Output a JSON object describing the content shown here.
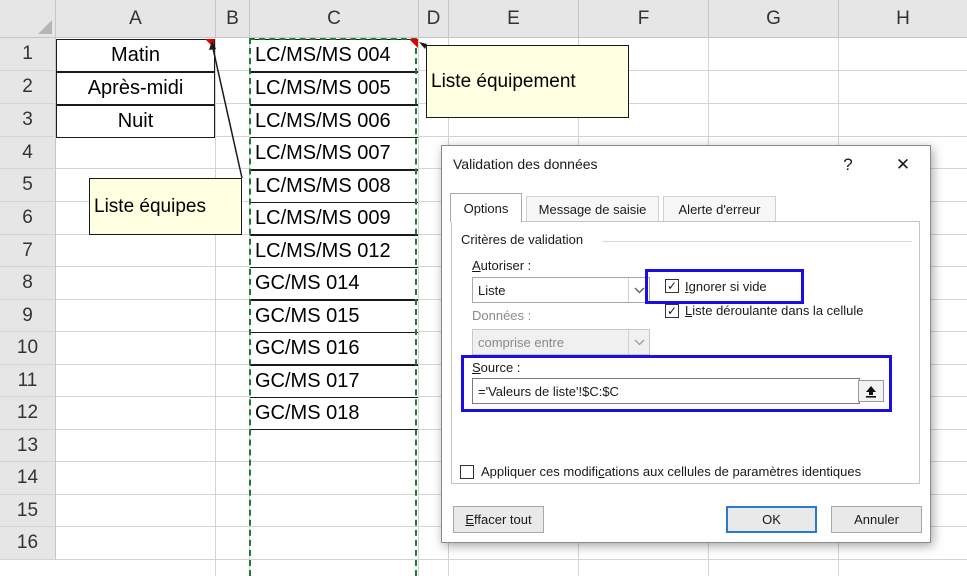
{
  "columns": [
    "A",
    "B",
    "C",
    "D",
    "E",
    "F",
    "G",
    "H"
  ],
  "rows": [
    "1",
    "2",
    "3",
    "4",
    "5",
    "6",
    "7",
    "8",
    "9",
    "10",
    "11",
    "12",
    "13",
    "14",
    "15",
    "16"
  ],
  "column_a": [
    "Matin",
    "Après-midi",
    "Nuit"
  ],
  "column_c": [
    "LC/MS/MS 004",
    "LC/MS/MS 005",
    "LC/MS/MS 006",
    "LC/MS/MS 007",
    "LC/MS/MS 008",
    "LC/MS/MS 009",
    "LC/MS/MS 012",
    "GC/MS 014",
    "GC/MS 015",
    "GC/MS 016",
    "GC/MS 017",
    "GC/MS 018"
  ],
  "comments": {
    "equipes": "Liste équipes",
    "equipement": "Liste équipement"
  },
  "dialog": {
    "title": "Validation des données",
    "help_label": "?",
    "close_label": "✕",
    "tabs": [
      "Options",
      "Message de saisie",
      "Alerte d'erreur"
    ],
    "group_label": "Critères de validation",
    "allow_label_u": "A",
    "allow_label_rest": "utoriser :",
    "allow_value": "Liste",
    "data_label": "Données :",
    "data_value": "comprise entre",
    "ignore_blank_u": "I",
    "ignore_blank_rest": "gnorer si vide",
    "ignore_blank_checked": true,
    "dropdown_u": "L",
    "dropdown_rest": "iste déroulante dans la cellule",
    "dropdown_checked": true,
    "source_label_u": "S",
    "source_label_rest": "ource :",
    "source_value": "='Valeurs de liste'!$C:$C",
    "apply_label_pre": "Appliquer ces modifi",
    "apply_label_u": "c",
    "apply_label_post": "ations aux cellules de paramètres identiques",
    "apply_checked": false,
    "clear_u": "E",
    "clear_rest": "ffacer tout",
    "ok_label": "OK",
    "cancel_label": "Annuler"
  },
  "colors": {
    "highlight": "#1a0fe0",
    "comment_bg": "#ffffe1",
    "marching_ants": "#1e7a35"
  }
}
